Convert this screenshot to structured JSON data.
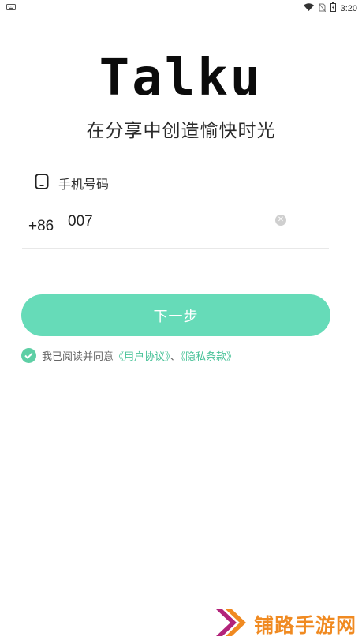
{
  "status_bar": {
    "left_icon": "keyboard-icon",
    "time": "3:20",
    "icons": [
      "wifi-icon",
      "sim-off-icon",
      "battery-icon"
    ]
  },
  "app": {
    "logo": "Talku",
    "slogan": "在分享中创造愉快时光"
  },
  "phone": {
    "label": "手机号码",
    "country_code": "+86",
    "value": "007",
    "placeholder": ""
  },
  "actions": {
    "next_label": "下一步"
  },
  "agreement": {
    "prefix": "我已阅读并同意",
    "user_agreement": "《用户协议》",
    "separator": "、",
    "privacy_policy": "《隐私条款》",
    "checked": true
  },
  "watermark": {
    "text": "铺路手游网"
  },
  "colors": {
    "accent": "#66dbb8",
    "link": "#4cc39a",
    "watermark": "#f08a21"
  }
}
